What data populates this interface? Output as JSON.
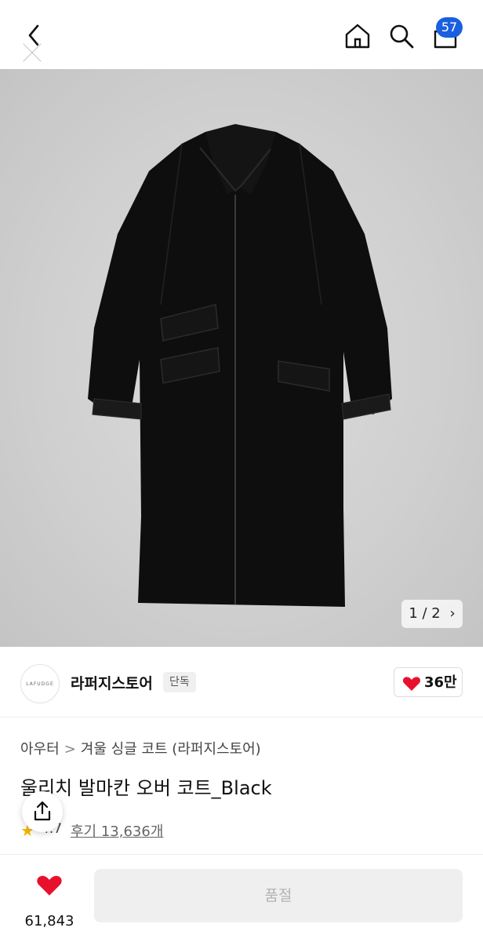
{
  "header": {
    "icons": {
      "back": "chevron-left-icon",
      "close": "close-icon",
      "home": "home-icon",
      "search": "search-icon",
      "cart": "shopping-bag-icon"
    },
    "cart_badge": "57",
    "badge_color": "#1a5fe0"
  },
  "gallery": {
    "page_indicator": "1 / 2",
    "next_glyph": "›"
  },
  "brand": {
    "logo_text": "LAFUDGE",
    "name": "라퍼지스토어",
    "tag": "단독",
    "like_count": "36만",
    "heart_color": "#e8112d"
  },
  "product": {
    "breadcrumb": [
      "아우터",
      "겨울 싱글 코트 (라퍼지스토어)"
    ],
    "breadcrumb_sep": ">",
    "title": "울리치 발마칸 오버 코트_Black",
    "rating": "4.7",
    "reviews": "후기 13,636개"
  },
  "bottom": {
    "wish_count": "61,843",
    "buy_label": "품절"
  }
}
